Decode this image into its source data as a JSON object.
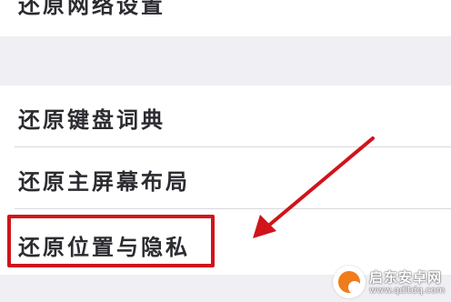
{
  "settings": {
    "top_item_label": "还原网络设置",
    "items": [
      {
        "label": "还原键盘词典"
      },
      {
        "label": "还原主屏幕布局"
      },
      {
        "label": "还原位置与隐私"
      }
    ]
  },
  "annotation": {
    "highlight_color": "#d0141a",
    "arrow_color": "#d0141a"
  },
  "watermark": {
    "title": "启东安卓网",
    "url": "www.qdltdq.com"
  }
}
